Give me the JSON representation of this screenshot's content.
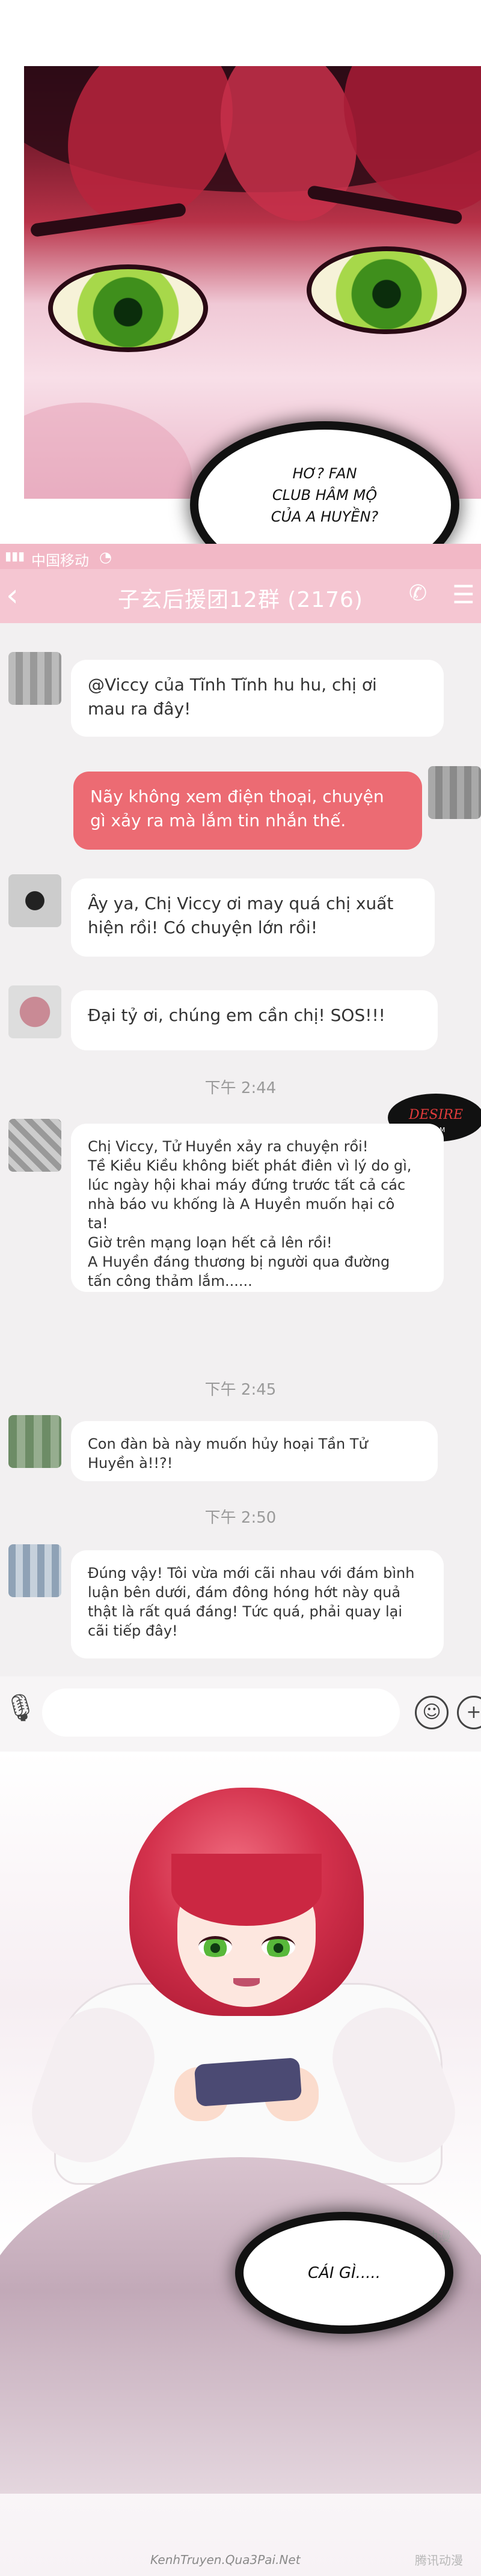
{
  "speech_top": "HƠ? FAN\nCLUB HÂM MỘ\nCỦA A HUYỀN?",
  "chat": {
    "status_carrier": "中国移动",
    "title": "子玄后援团12群 (2176)",
    "messages": [
      {
        "id": "m1",
        "text": "@Viccy của Tĩnh Tĩnh hu hu, chị ơi\nmau ra đây!"
      },
      {
        "id": "m2",
        "text": "Nãy không xem điện thoại, chuyện\ngì xảy ra mà lắm tin nhắn thế."
      },
      {
        "id": "m3",
        "text": "Ây ya, Chị Viccy ơi may quá chị xuất\nhiện rồi! Có chuyện lớn rồi!"
      },
      {
        "id": "m4",
        "text": "Đại tỷ ơi, chúng em cần chị! SOS!!!"
      },
      {
        "id": "m5",
        "text": "Chị Viccy, Tử Huyền xảy ra chuyện rồi!\nTề Kiều Kiều không biết phát điên vì lý do gì,\nlúc ngày hội khai máy đứng trước tất cả các\nnhà báo vu khống là A Huyền muốn hại cô\nta!\nGiờ trên mạng loạn hết cả lên rồi!\nA Huyền đáng thương bị người qua đường\ntấn công thảm lắm......"
      },
      {
        "id": "m6",
        "text": "Con đàn bà này muốn hủy hoại Tần Tử\nHuyền à!!?!"
      },
      {
        "id": "m7",
        "text": "Đúng vậy! Tôi vừa mới cãi nhau với đám bình\nluận bên dưới, đám đông hóng hớt này quả\nthật là rất quá đáng! Tức quá, phải quay lại\ncãi tiếp đây!"
      }
    ],
    "timestamps": [
      "下午 2:44",
      "下午 2:45",
      "下午 2:50"
    ]
  },
  "logo_text": "DESIRE TEAM",
  "speech_bottom": "CÁI GÌ.....",
  "watermark_bottom": "KenhTruyen.Qua3Pai.Net",
  "corner_watermark": "腾讯动漫",
  "colors": {
    "accent": "#ec6b73",
    "nav": "#f5c6d2",
    "hair": "#c2233f",
    "eye": "#58b83a"
  }
}
